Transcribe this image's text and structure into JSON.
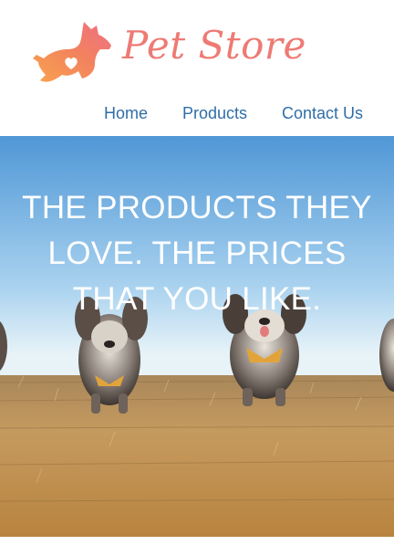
{
  "brand": {
    "name": "Pet Store",
    "logo_icon": "dog-heart-logo-icon",
    "color": "#ee7a74"
  },
  "nav": {
    "items": [
      {
        "label": "Home"
      },
      {
        "label": "Products"
      },
      {
        "label": "Contact Us"
      }
    ],
    "color": "#2f6ea8"
  },
  "hero": {
    "headline": "THE PRODUCTS THEY LOVE. THE PRICES THAT YOU LIKE.",
    "image": "running-dogs-in-field-photo",
    "text_color": "#ffffff"
  }
}
